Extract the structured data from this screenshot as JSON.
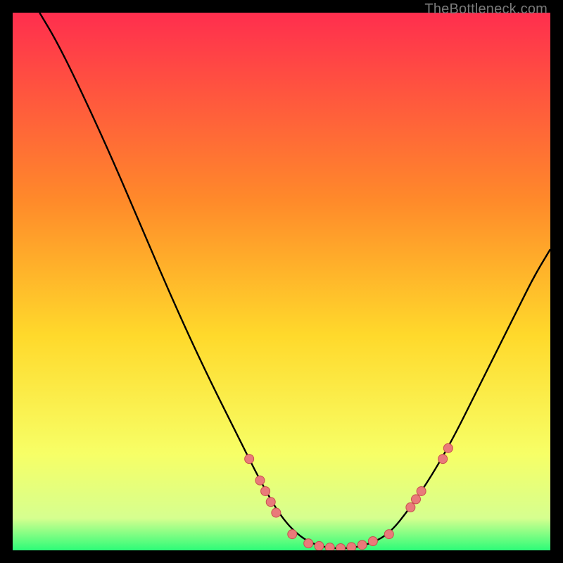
{
  "watermark": "TheBottleneck.com",
  "colors": {
    "gradient_top": "#ff2e4e",
    "gradient_mid1": "#ff6a3a",
    "gradient_mid2": "#ffd92b",
    "gradient_mid3": "#f7ff66",
    "gradient_bottom": "#2dfc78",
    "curve": "#000000",
    "marker_fill": "#e97a7a",
    "marker_stroke": "#c94f4f",
    "background": "#000000"
  },
  "chart_data": {
    "type": "line",
    "title": "",
    "xlabel": "",
    "ylabel": "",
    "xlim": [
      0,
      100
    ],
    "ylim": [
      0,
      100
    ],
    "curve": [
      {
        "x": 5,
        "y": 100
      },
      {
        "x": 8,
        "y": 95
      },
      {
        "x": 12,
        "y": 87
      },
      {
        "x": 18,
        "y": 74
      },
      {
        "x": 24,
        "y": 60
      },
      {
        "x": 30,
        "y": 46
      },
      {
        "x": 36,
        "y": 33
      },
      {
        "x": 42,
        "y": 21
      },
      {
        "x": 46,
        "y": 13
      },
      {
        "x": 50,
        "y": 6
      },
      {
        "x": 54,
        "y": 2
      },
      {
        "x": 58,
        "y": 0.5
      },
      {
        "x": 62,
        "y": 0.3
      },
      {
        "x": 66,
        "y": 1
      },
      {
        "x": 70,
        "y": 3
      },
      {
        "x": 74,
        "y": 8
      },
      {
        "x": 78,
        "y": 14
      },
      {
        "x": 82,
        "y": 21
      },
      {
        "x": 86,
        "y": 29
      },
      {
        "x": 90,
        "y": 37
      },
      {
        "x": 94,
        "y": 45
      },
      {
        "x": 97,
        "y": 51
      },
      {
        "x": 100,
        "y": 56
      }
    ],
    "markers": [
      {
        "x": 44,
        "y": 17
      },
      {
        "x": 46,
        "y": 13
      },
      {
        "x": 47,
        "y": 11
      },
      {
        "x": 48,
        "y": 9
      },
      {
        "x": 49,
        "y": 7
      },
      {
        "x": 52,
        "y": 3
      },
      {
        "x": 55,
        "y": 1.3
      },
      {
        "x": 57,
        "y": 0.8
      },
      {
        "x": 59,
        "y": 0.5
      },
      {
        "x": 61,
        "y": 0.4
      },
      {
        "x": 63,
        "y": 0.6
      },
      {
        "x": 65,
        "y": 1
      },
      {
        "x": 67,
        "y": 1.7
      },
      {
        "x": 70,
        "y": 3
      },
      {
        "x": 74,
        "y": 8
      },
      {
        "x": 75,
        "y": 9.5
      },
      {
        "x": 76,
        "y": 11
      },
      {
        "x": 80,
        "y": 17
      },
      {
        "x": 81,
        "y": 19
      }
    ]
  }
}
